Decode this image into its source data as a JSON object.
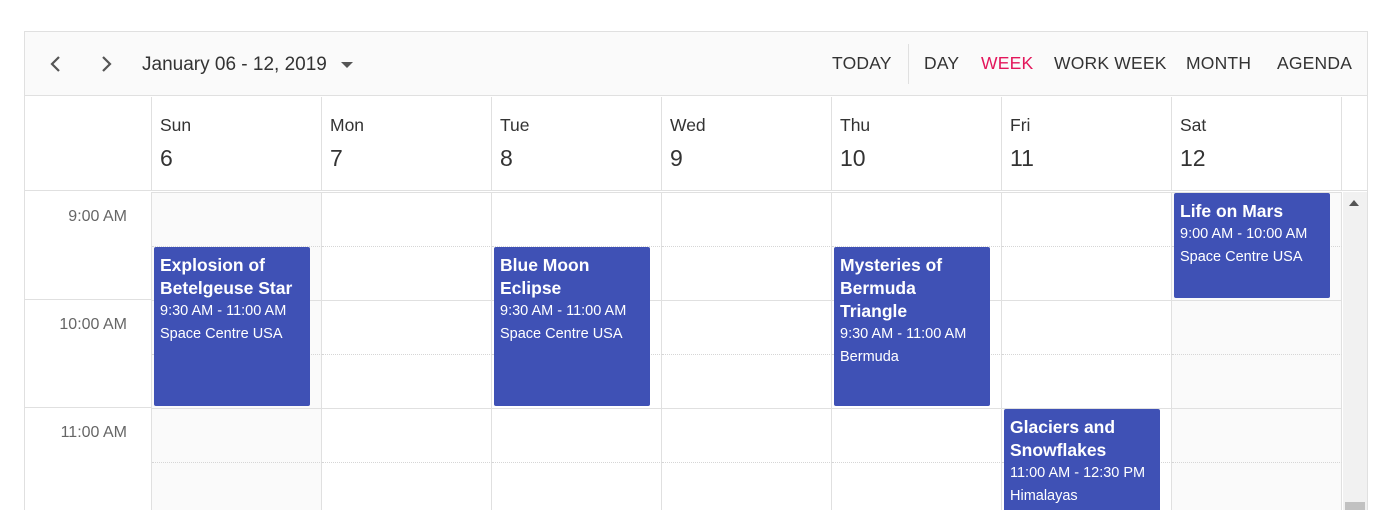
{
  "toolbar": {
    "date_range": "January 06 - 12, 2019",
    "today": "TODAY",
    "views": [
      "DAY",
      "WEEK",
      "WORK WEEK",
      "MONTH",
      "AGENDA"
    ],
    "active_view": "WEEK"
  },
  "days": [
    {
      "name": "Sun",
      "date": "6"
    },
    {
      "name": "Mon",
      "date": "7"
    },
    {
      "name": "Tue",
      "date": "8"
    },
    {
      "name": "Wed",
      "date": "9"
    },
    {
      "name": "Thu",
      "date": "10"
    },
    {
      "name": "Fri",
      "date": "11"
    },
    {
      "name": "Sat",
      "date": "12"
    }
  ],
  "times": [
    "9:00 AM",
    "10:00 AM",
    "11:00 AM"
  ],
  "appointments": [
    {
      "subject": "Explosion of Betelgeuse Star",
      "time": "9:30 AM - 11:00 AM",
      "location": "Space Centre USA"
    },
    {
      "subject": "Blue Moon Eclipse",
      "time": "9:30 AM - 11:00 AM",
      "location": "Space Centre USA"
    },
    {
      "subject": "Mysteries of Bermuda Triangle",
      "time": "9:30 AM - 11:00 AM",
      "location": "Bermuda"
    },
    {
      "subject": "Glaciers and Snowflakes",
      "time": "11:00 AM - 12:30 PM",
      "location": "Himalayas"
    },
    {
      "subject": "Life on Mars",
      "time": "9:00 AM - 10:00 AM",
      "location": "Space Centre USA"
    }
  ],
  "colors": {
    "accent": "#e3165b",
    "appointment": "#3f51b5"
  }
}
